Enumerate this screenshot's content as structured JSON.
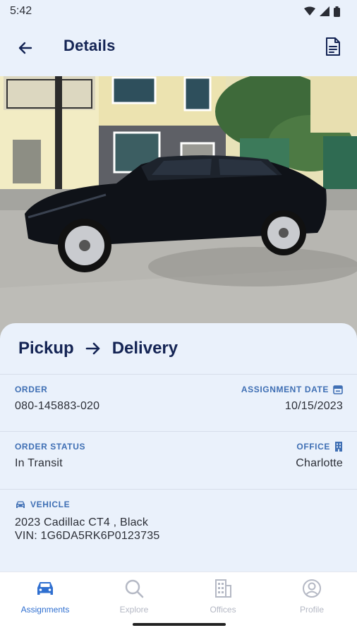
{
  "status_bar": {
    "time": "5:42"
  },
  "app_bar": {
    "title": "Details"
  },
  "route": {
    "from": "Pickup",
    "to": "Delivery"
  },
  "order": {
    "label": "ORDER",
    "value": "080-145883-020"
  },
  "assignment_date": {
    "label": "ASSIGNMENT DATE",
    "value": "10/15/2023"
  },
  "order_status": {
    "label": "ORDER STATUS",
    "value": "In Transit"
  },
  "office": {
    "label": "OFFICE",
    "value": "Charlotte"
  },
  "vehicle": {
    "label": "VEHICLE",
    "line1": "2023 Cadillac CT4 , Black",
    "line2": "VIN: 1G6DA5RK6P0123735"
  },
  "nav": {
    "items": [
      {
        "label": "Assignments",
        "icon": "car-icon",
        "active": true
      },
      {
        "label": "Explore",
        "icon": "search-icon",
        "active": false
      },
      {
        "label": "Offices",
        "icon": "building-icon",
        "active": false
      },
      {
        "label": "Profile",
        "icon": "profile-icon",
        "active": false
      }
    ]
  },
  "colors": {
    "accent": "#2f6fd0",
    "title": "#142454",
    "label": "#3f6fb4",
    "background": "#eaf1fb"
  }
}
